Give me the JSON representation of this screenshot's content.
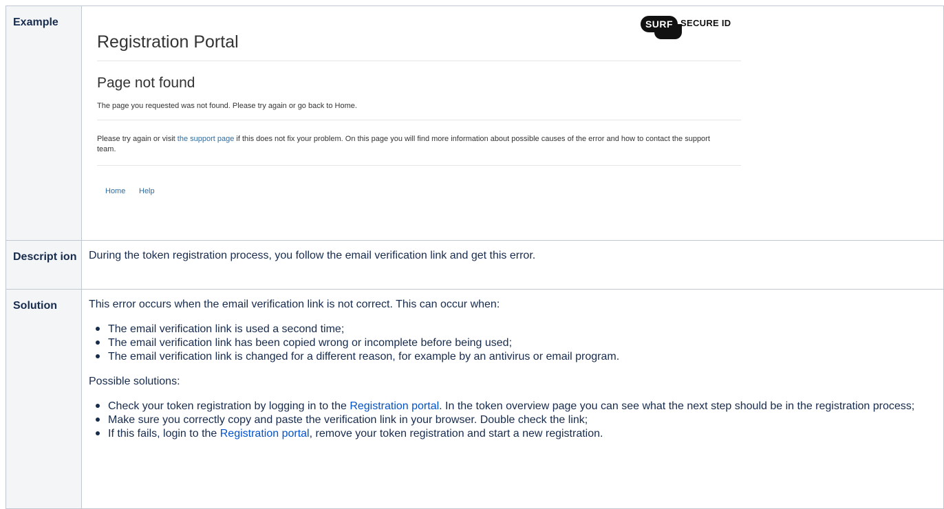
{
  "headers": {
    "example": "Example",
    "description": "Descript ion",
    "solution": "Solution"
  },
  "example": {
    "portal_title": "Registration Portal",
    "logo": {
      "left": "SURF",
      "right": "SECURE ID"
    },
    "page_not_found_title": "Page not found",
    "page_not_found_text": "The page you requested was not found. Please try again or go back to Home.",
    "support_prefix": "Please try again or visit ",
    "support_link": "the support page",
    "support_suffix": " if this does not fix your problem. On this page you will find more information about possible causes of the error and how to contact the support team.",
    "nav": {
      "home": "Home",
      "help": "Help"
    }
  },
  "description": {
    "text": "During the token registration process, you follow the email verification link and get this error."
  },
  "solution": {
    "intro": "This error occurs when the email verification link is not correct. This can occur when:",
    "causes": [
      "The email verification link is used a second time;",
      "The email verification link has been copied wrong or incomplete before being used;",
      "The email verification link is changed for a different reason, for example by an antivirus or email program."
    ],
    "solutions_heading": "Possible solutions:",
    "sol1_prefix": "Check your token registration by logging in to the ",
    "sol1_link": "Registration portal",
    "sol1_suffix": ". In the token overview page you can see what the next step should be in the registration process;",
    "sol2": "Make sure you correctly copy and paste the verification link in your browser. Double check the link;",
    "sol3_prefix": "If this fails, login to the ",
    "sol3_link": "Registration portal",
    "sol3_suffix": ", remove your token registration and start a new registration."
  }
}
